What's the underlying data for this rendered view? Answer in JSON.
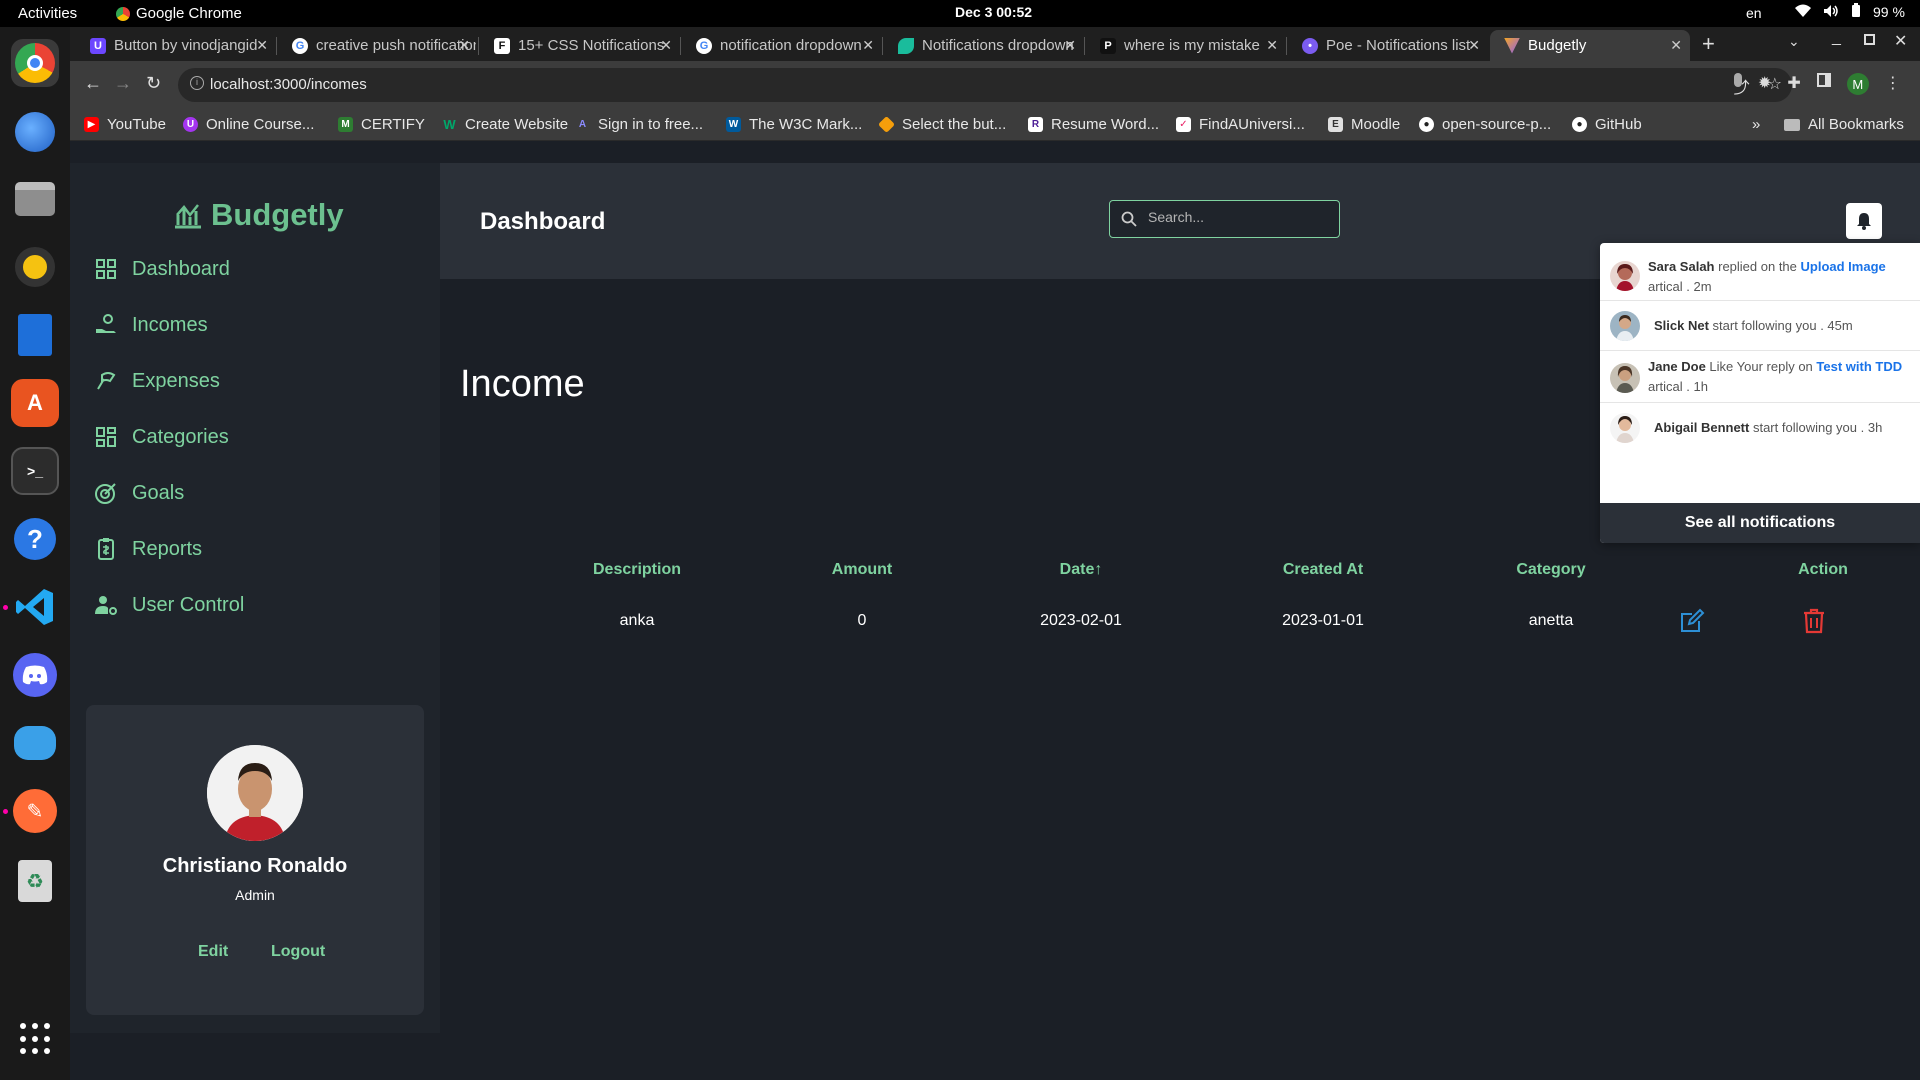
{
  "os": {
    "activities": "Activities",
    "app_name": "Google Chrome",
    "clock": "Dec 3  00:52",
    "lang": "en",
    "battery": "99 %"
  },
  "browser": {
    "tabs": [
      {
        "title": "Button by vinodjangid",
        "icon": "uiverse-icon",
        "color": "#6c47ff"
      },
      {
        "title": "creative push notifications",
        "icon": "google-icon",
        "color": "#4285f4"
      },
      {
        "title": "15+ CSS Notifications",
        "icon": "freefrontend-icon",
        "color": "#333333"
      },
      {
        "title": "notification dropdown",
        "icon": "google-icon",
        "color": "#4285f4"
      },
      {
        "title": "Notifications dropdown",
        "icon": "leaf-icon",
        "color": "#1abc9c"
      },
      {
        "title": "where is my mistake",
        "icon": "p-icon",
        "color": "#111111"
      },
      {
        "title": "Poe - Notifications list",
        "icon": "poe-icon",
        "color": "#7b5cf0"
      },
      {
        "title": "Budgetly",
        "icon": "budgetly-icon",
        "color": "#8a5cf5",
        "active": true
      }
    ],
    "url": "localhost:3000/incomes",
    "bookmarks": [
      {
        "label": "YouTube",
        "color": "#ff0000"
      },
      {
        "label": "Online Course...",
        "color": "#a435f0"
      },
      {
        "label": "CERTIFY",
        "color": "#2e7d32"
      },
      {
        "label": "Create Website",
        "color": "#00a86b"
      },
      {
        "label": "Sign in to free...",
        "color": "#5b4cff"
      },
      {
        "label": "The W3C Mark...",
        "color": "#005a9c"
      },
      {
        "label": "Select the but...",
        "color": "#f59e0b"
      },
      {
        "label": "Resume Word...",
        "color": "#4c1d95"
      },
      {
        "label": "FindAUniversi...",
        "color": "#e91e63"
      },
      {
        "label": "Moodle",
        "color": "#f98012"
      },
      {
        "label": "open-source-p...",
        "color": "#222222"
      },
      {
        "label": "GitHub",
        "color": "#222222"
      }
    ],
    "more_bookmarks": "»",
    "all_bookmarks": "All Bookmarks"
  },
  "app": {
    "brand": "Budgetly",
    "brand_color": "#6cc08f",
    "nav": [
      {
        "label": "Dashboard",
        "icon": "grid-icon"
      },
      {
        "label": "Incomes",
        "icon": "hand-coin-icon"
      },
      {
        "label": "Expenses",
        "icon": "money-fly-icon"
      },
      {
        "label": "Categories",
        "icon": "categories-icon"
      },
      {
        "label": "Goals",
        "icon": "target-icon"
      },
      {
        "label": "Reports",
        "icon": "report-icon"
      },
      {
        "label": "User Control",
        "icon": "user-gear-icon"
      }
    ],
    "profile": {
      "name": "Christiano Ronaldo",
      "role": "Admin",
      "edit": "Edit",
      "logout": "Logout"
    },
    "header": {
      "title": "Dashboard",
      "search_placeholder": "Search..."
    },
    "page_title": "Income",
    "table": {
      "headers": [
        "Description",
        "Amount",
        "Date↑",
        "Created At",
        "Category",
        "Action"
      ],
      "rows": [
        {
          "description": "anka",
          "amount": "0",
          "date": "2023-02-01",
          "created_at": "2023-01-01",
          "category": "anetta"
        }
      ]
    },
    "notifications": {
      "items": [
        {
          "user": "Sara Salah",
          "text": " replied on the ",
          "link": "Upload Image",
          "suffix": " artical . 2m"
        },
        {
          "user": "Slick Net",
          "text": " start following you . 45m",
          "link": "",
          "suffix": ""
        },
        {
          "user": "Jane Doe",
          "text": " Like Your reply on ",
          "link": "Test with TDD",
          "suffix": " artical . 1h"
        },
        {
          "user": "Abigail Bennett",
          "text": " start following you . 3h",
          "link": "",
          "suffix": ""
        }
      ],
      "see_all": "See all notifications"
    }
  }
}
